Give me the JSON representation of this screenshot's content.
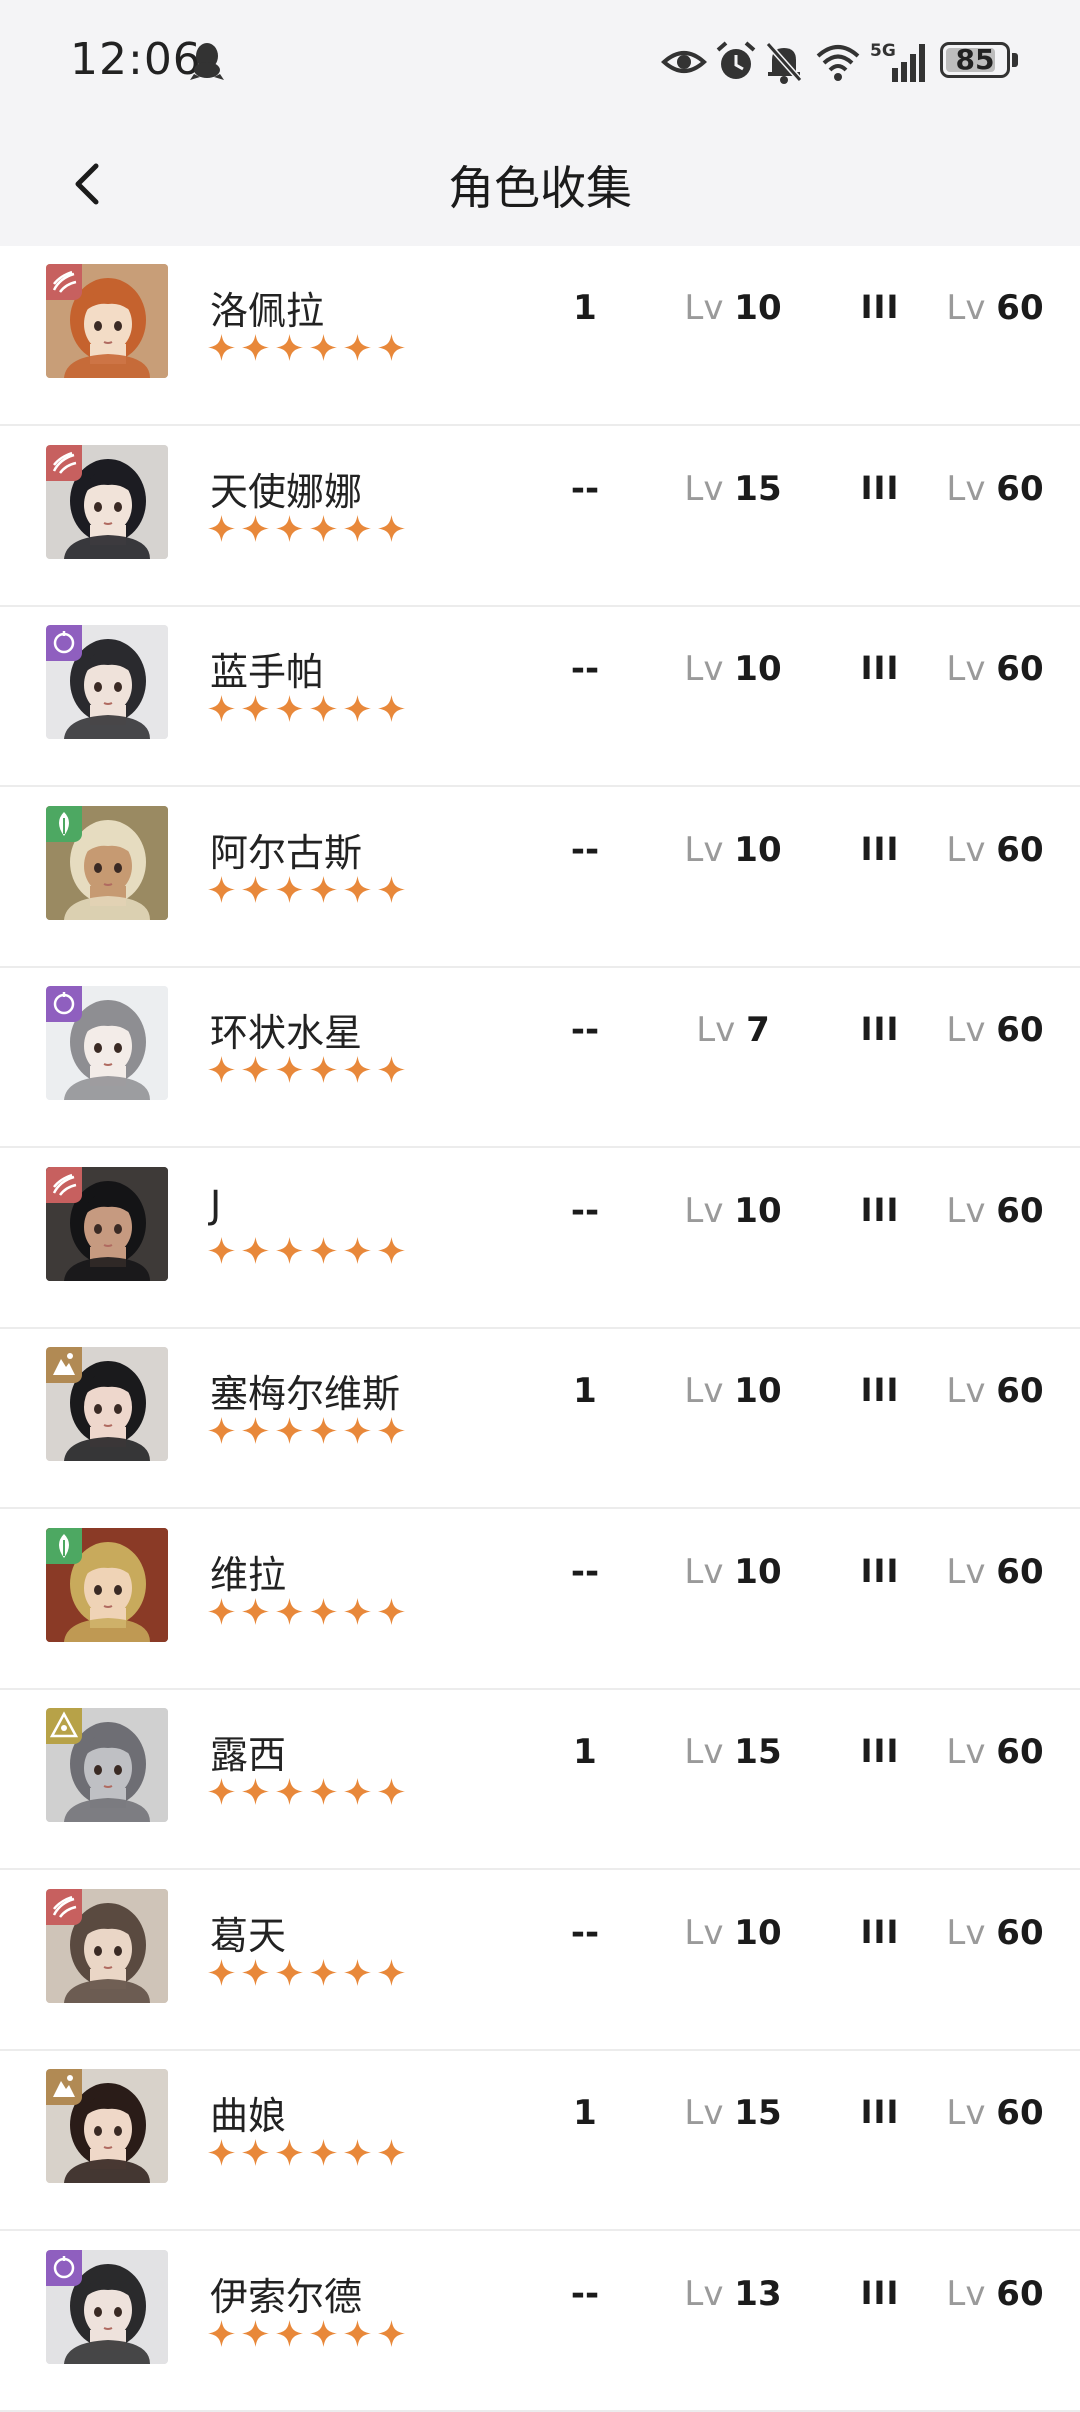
{
  "status_bar": {
    "time": "12:06",
    "battery": "85",
    "battery_level": 0.85,
    "icons": [
      "qq-icon",
      "eye-icon",
      "alarm-icon",
      "bell-off-icon",
      "wifi-icon",
      "signal-5g-icon",
      "battery-icon"
    ]
  },
  "header": {
    "title": "角色收集",
    "back_icon": "chevron-left-icon"
  },
  "colors": {
    "star": "#e8883a",
    "lv_prefix": "#9a9a9a",
    "header_bg": "#f4f4f6",
    "divider": "#ececec"
  },
  "element_colors": {
    "wind": "#c7605f",
    "spirit": "#8f5fbf",
    "plant": "#4da862",
    "intellect": "#b18a54",
    "star_sign": "#b7a248"
  },
  "characters": [
    {
      "name": "洛佩拉",
      "stars": 6,
      "element": "wind",
      "count": "1",
      "lv_prefix": "Lv",
      "level": "10",
      "rank": "III",
      "max_lv": "60",
      "hair": "#c5622e",
      "bg": "#c89e78",
      "skin": "#f3dcc6"
    },
    {
      "name": "天使娜娜",
      "stars": 6,
      "element": "wind",
      "count": "--",
      "lv_prefix": "Lv",
      "level": "15",
      "rank": "III",
      "max_lv": "60",
      "hair": "#1c1c22",
      "bg": "#d6d3d0",
      "skin": "#f1e3d9"
    },
    {
      "name": "蓝手帕",
      "stars": 6,
      "element": "spirit",
      "count": "--",
      "lv_prefix": "Lv",
      "level": "10",
      "rank": "III",
      "max_lv": "60",
      "hair": "#2a2a2e",
      "bg": "#e6e6e8",
      "skin": "#efe2da"
    },
    {
      "name": "阿尔古斯",
      "stars": 6,
      "element": "plant",
      "count": "--",
      "lv_prefix": "Lv",
      "level": "10",
      "rank": "III",
      "max_lv": "60",
      "hair": "#e6dcc0",
      "bg": "#9a8a62",
      "skin": "#c69a72"
    },
    {
      "name": "环状水星",
      "stars": 6,
      "element": "spirit",
      "count": "--",
      "lv_prefix": "Lv",
      "level": "7",
      "rank": "III",
      "max_lv": "60",
      "hair": "#8e8e92",
      "bg": "#eceef0",
      "skin": "#f3ece8"
    },
    {
      "name": "J",
      "stars": 6,
      "element": "wind",
      "count": "--",
      "lv_prefix": "Lv",
      "level": "10",
      "rank": "III",
      "max_lv": "60",
      "hair": "#141416",
      "bg": "#3e3a38",
      "skin": "#c69a80"
    },
    {
      "name": "塞梅尔维斯",
      "stars": 6,
      "element": "intellect",
      "count": "1",
      "lv_prefix": "Lv",
      "level": "10",
      "rank": "III",
      "max_lv": "60",
      "hair": "#1a1a1c",
      "bg": "#d8d4d0",
      "skin": "#eed7cc"
    },
    {
      "name": "维拉",
      "stars": 6,
      "element": "plant",
      "count": "--",
      "lv_prefix": "Lv",
      "level": "10",
      "rank": "III",
      "max_lv": "60",
      "hair": "#c8aa5c",
      "bg": "#8a3a26",
      "skin": "#efd3b6"
    },
    {
      "name": "露西",
      "stars": 6,
      "element": "star_sign",
      "count": "1",
      "lv_prefix": "Lv",
      "level": "15",
      "rank": "III",
      "max_lv": "60",
      "hair": "#6e6e74",
      "bg": "#d0d0d0",
      "skin": "#bfc0c4"
    },
    {
      "name": "葛天",
      "stars": 6,
      "element": "wind",
      "count": "--",
      "lv_prefix": "Lv",
      "level": "10",
      "rank": "III",
      "max_lv": "60",
      "hair": "#5a4a40",
      "bg": "#cfc4b8",
      "skin": "#ead6c6"
    },
    {
      "name": "曲娘",
      "stars": 6,
      "element": "intellect",
      "count": "1",
      "lv_prefix": "Lv",
      "level": "15",
      "rank": "III",
      "max_lv": "60",
      "hair": "#2a1c18",
      "bg": "#d8d2ca",
      "skin": "#efd8c8"
    },
    {
      "name": "伊索尔德",
      "stars": 6,
      "element": "spirit",
      "count": "--",
      "lv_prefix": "Lv",
      "level": "13",
      "rank": "III",
      "max_lv": "60",
      "hair": "#2a2a2c",
      "bg": "#e2e2e4",
      "skin": "#eee2dc"
    }
  ]
}
